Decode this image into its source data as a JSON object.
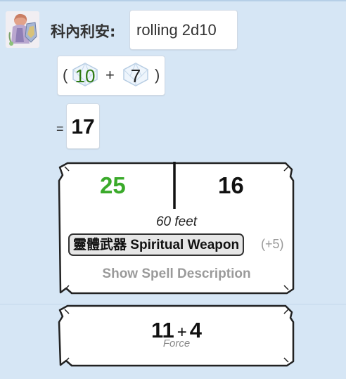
{
  "message": {
    "sender": "科內利安:",
    "text": "rolling 2d10"
  },
  "roll": {
    "open_paren": "(",
    "die1": "10",
    "plus": "+",
    "die2": "7",
    "close_paren": ")",
    "equals": "=",
    "total": "17"
  },
  "attack_card": {
    "roll1": "25",
    "roll2": "16",
    "range": "60 feet",
    "spell_name_cjk": "靈體武器",
    "spell_name": "Spiritual Weapon",
    "modifier": "(+5)",
    "show_description": "Show Spell Description"
  },
  "damage_card": {
    "left": "11",
    "op": "+",
    "right": "4",
    "type": "Force"
  },
  "colors": {
    "page_bg": "#d6e6f5",
    "crit_green": "#3aaa2a",
    "die_green": "#2f7a12"
  },
  "icons": {
    "avatar": "character-portrait",
    "die": "d10-die-icon"
  }
}
